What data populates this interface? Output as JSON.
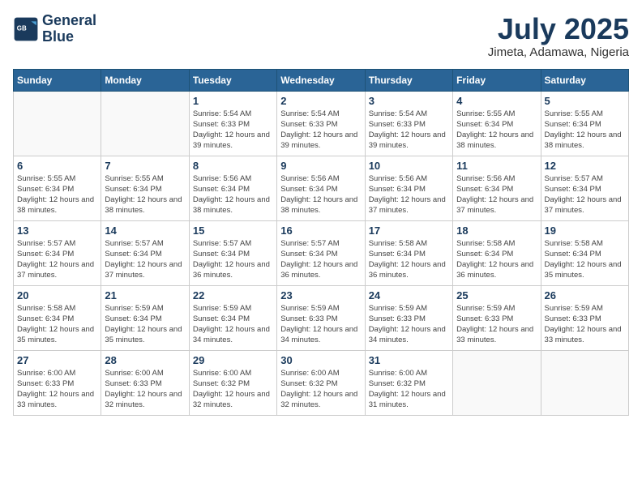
{
  "header": {
    "logo_line1": "General",
    "logo_line2": "Blue",
    "month_title": "July 2025",
    "location": "Jimeta, Adamawa, Nigeria"
  },
  "calendar": {
    "days_of_week": [
      "Sunday",
      "Monday",
      "Tuesday",
      "Wednesday",
      "Thursday",
      "Friday",
      "Saturday"
    ],
    "weeks": [
      [
        {
          "day": "",
          "info": ""
        },
        {
          "day": "",
          "info": ""
        },
        {
          "day": "1",
          "info": "Sunrise: 5:54 AM\nSunset: 6:33 PM\nDaylight: 12 hours and 39 minutes."
        },
        {
          "day": "2",
          "info": "Sunrise: 5:54 AM\nSunset: 6:33 PM\nDaylight: 12 hours and 39 minutes."
        },
        {
          "day": "3",
          "info": "Sunrise: 5:54 AM\nSunset: 6:33 PM\nDaylight: 12 hours and 39 minutes."
        },
        {
          "day": "4",
          "info": "Sunrise: 5:55 AM\nSunset: 6:34 PM\nDaylight: 12 hours and 38 minutes."
        },
        {
          "day": "5",
          "info": "Sunrise: 5:55 AM\nSunset: 6:34 PM\nDaylight: 12 hours and 38 minutes."
        }
      ],
      [
        {
          "day": "6",
          "info": "Sunrise: 5:55 AM\nSunset: 6:34 PM\nDaylight: 12 hours and 38 minutes."
        },
        {
          "day": "7",
          "info": "Sunrise: 5:55 AM\nSunset: 6:34 PM\nDaylight: 12 hours and 38 minutes."
        },
        {
          "day": "8",
          "info": "Sunrise: 5:56 AM\nSunset: 6:34 PM\nDaylight: 12 hours and 38 minutes."
        },
        {
          "day": "9",
          "info": "Sunrise: 5:56 AM\nSunset: 6:34 PM\nDaylight: 12 hours and 38 minutes."
        },
        {
          "day": "10",
          "info": "Sunrise: 5:56 AM\nSunset: 6:34 PM\nDaylight: 12 hours and 37 minutes."
        },
        {
          "day": "11",
          "info": "Sunrise: 5:56 AM\nSunset: 6:34 PM\nDaylight: 12 hours and 37 minutes."
        },
        {
          "day": "12",
          "info": "Sunrise: 5:57 AM\nSunset: 6:34 PM\nDaylight: 12 hours and 37 minutes."
        }
      ],
      [
        {
          "day": "13",
          "info": "Sunrise: 5:57 AM\nSunset: 6:34 PM\nDaylight: 12 hours and 37 minutes."
        },
        {
          "day": "14",
          "info": "Sunrise: 5:57 AM\nSunset: 6:34 PM\nDaylight: 12 hours and 37 minutes."
        },
        {
          "day": "15",
          "info": "Sunrise: 5:57 AM\nSunset: 6:34 PM\nDaylight: 12 hours and 36 minutes."
        },
        {
          "day": "16",
          "info": "Sunrise: 5:57 AM\nSunset: 6:34 PM\nDaylight: 12 hours and 36 minutes."
        },
        {
          "day": "17",
          "info": "Sunrise: 5:58 AM\nSunset: 6:34 PM\nDaylight: 12 hours and 36 minutes."
        },
        {
          "day": "18",
          "info": "Sunrise: 5:58 AM\nSunset: 6:34 PM\nDaylight: 12 hours and 36 minutes."
        },
        {
          "day": "19",
          "info": "Sunrise: 5:58 AM\nSunset: 6:34 PM\nDaylight: 12 hours and 35 minutes."
        }
      ],
      [
        {
          "day": "20",
          "info": "Sunrise: 5:58 AM\nSunset: 6:34 PM\nDaylight: 12 hours and 35 minutes."
        },
        {
          "day": "21",
          "info": "Sunrise: 5:59 AM\nSunset: 6:34 PM\nDaylight: 12 hours and 35 minutes."
        },
        {
          "day": "22",
          "info": "Sunrise: 5:59 AM\nSunset: 6:34 PM\nDaylight: 12 hours and 34 minutes."
        },
        {
          "day": "23",
          "info": "Sunrise: 5:59 AM\nSunset: 6:33 PM\nDaylight: 12 hours and 34 minutes."
        },
        {
          "day": "24",
          "info": "Sunrise: 5:59 AM\nSunset: 6:33 PM\nDaylight: 12 hours and 34 minutes."
        },
        {
          "day": "25",
          "info": "Sunrise: 5:59 AM\nSunset: 6:33 PM\nDaylight: 12 hours and 33 minutes."
        },
        {
          "day": "26",
          "info": "Sunrise: 5:59 AM\nSunset: 6:33 PM\nDaylight: 12 hours and 33 minutes."
        }
      ],
      [
        {
          "day": "27",
          "info": "Sunrise: 6:00 AM\nSunset: 6:33 PM\nDaylight: 12 hours and 33 minutes."
        },
        {
          "day": "28",
          "info": "Sunrise: 6:00 AM\nSunset: 6:33 PM\nDaylight: 12 hours and 32 minutes."
        },
        {
          "day": "29",
          "info": "Sunrise: 6:00 AM\nSunset: 6:32 PM\nDaylight: 12 hours and 32 minutes."
        },
        {
          "day": "30",
          "info": "Sunrise: 6:00 AM\nSunset: 6:32 PM\nDaylight: 12 hours and 32 minutes."
        },
        {
          "day": "31",
          "info": "Sunrise: 6:00 AM\nSunset: 6:32 PM\nDaylight: 12 hours and 31 minutes."
        },
        {
          "day": "",
          "info": ""
        },
        {
          "day": "",
          "info": ""
        }
      ]
    ]
  }
}
